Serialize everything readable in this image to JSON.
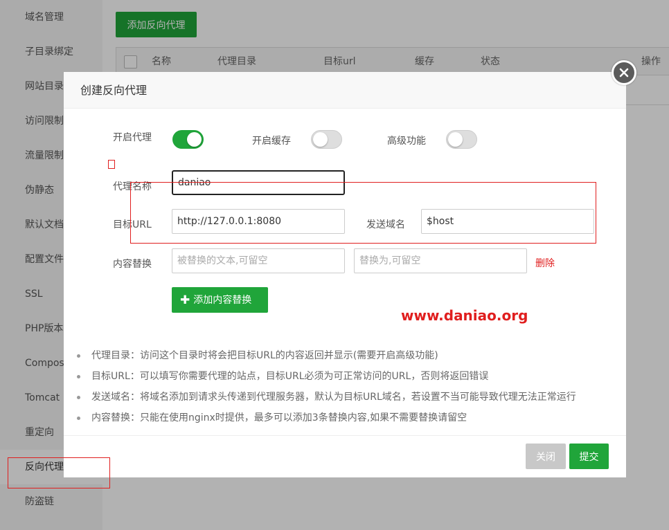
{
  "sidebar": {
    "items": [
      {
        "label": "域名管理"
      },
      {
        "label": "子目录绑定"
      },
      {
        "label": "网站目录"
      },
      {
        "label": "访问限制"
      },
      {
        "label": "流量限制"
      },
      {
        "label": "伪静态"
      },
      {
        "label": "默认文档"
      },
      {
        "label": "配置文件"
      },
      {
        "label": "SSL"
      },
      {
        "label": "PHP版本"
      },
      {
        "label": "Composer"
      },
      {
        "label": "Tomcat"
      },
      {
        "label": "重定向"
      },
      {
        "label": "反向代理"
      },
      {
        "label": "防盗链"
      }
    ]
  },
  "main": {
    "add_proxy_label": "添加反向代理",
    "table": {
      "headers": [
        "名称",
        "代理目录",
        "目标url",
        "缓存",
        "状态",
        "操作"
      ]
    }
  },
  "modal": {
    "title": "创建反向代理",
    "toggles": {
      "proxy_label": "开启代理",
      "proxy_on": true,
      "cache_label": "开启缓存",
      "cache_on": false,
      "advanced_label": "高级功能",
      "advanced_on": false
    },
    "form": {
      "name_label": "代理名称",
      "name_value": "daniao",
      "target_label": "目标URL",
      "target_value": "http://127.0.0.1:8080",
      "host_label": "发送域名",
      "host_value": "$host",
      "replace_label": "内容替换",
      "replace_from_placeholder": "被替换的文本,可留空",
      "replace_to_placeholder": "替换为,可留空",
      "delete_label": "删除",
      "add_replace_label": "添加内容替换"
    },
    "watermark": "www.daniao.org",
    "tips": [
      "代理目录：访问这个目录时将会把目标URL的内容返回并显示(需要开启高级功能)",
      "目标URL：可以填写你需要代理的站点，目标URL必须为可正常访问的URL，否则将返回错误",
      "发送域名：将域名添加到请求头传递到代理服务器，默认为目标URL域名，若设置不当可能导致代理无法正常运行",
      "内容替换：只能在使用nginx时提供，最多可以添加3条替换内容,如果不需要替换请留空"
    ],
    "footer": {
      "close_label": "关闭",
      "submit_label": "提交"
    }
  },
  "colors": {
    "accent": "#20a53a",
    "danger": "#e01e1e"
  },
  "icons": [
    "close-icon",
    "plus-icon"
  ]
}
